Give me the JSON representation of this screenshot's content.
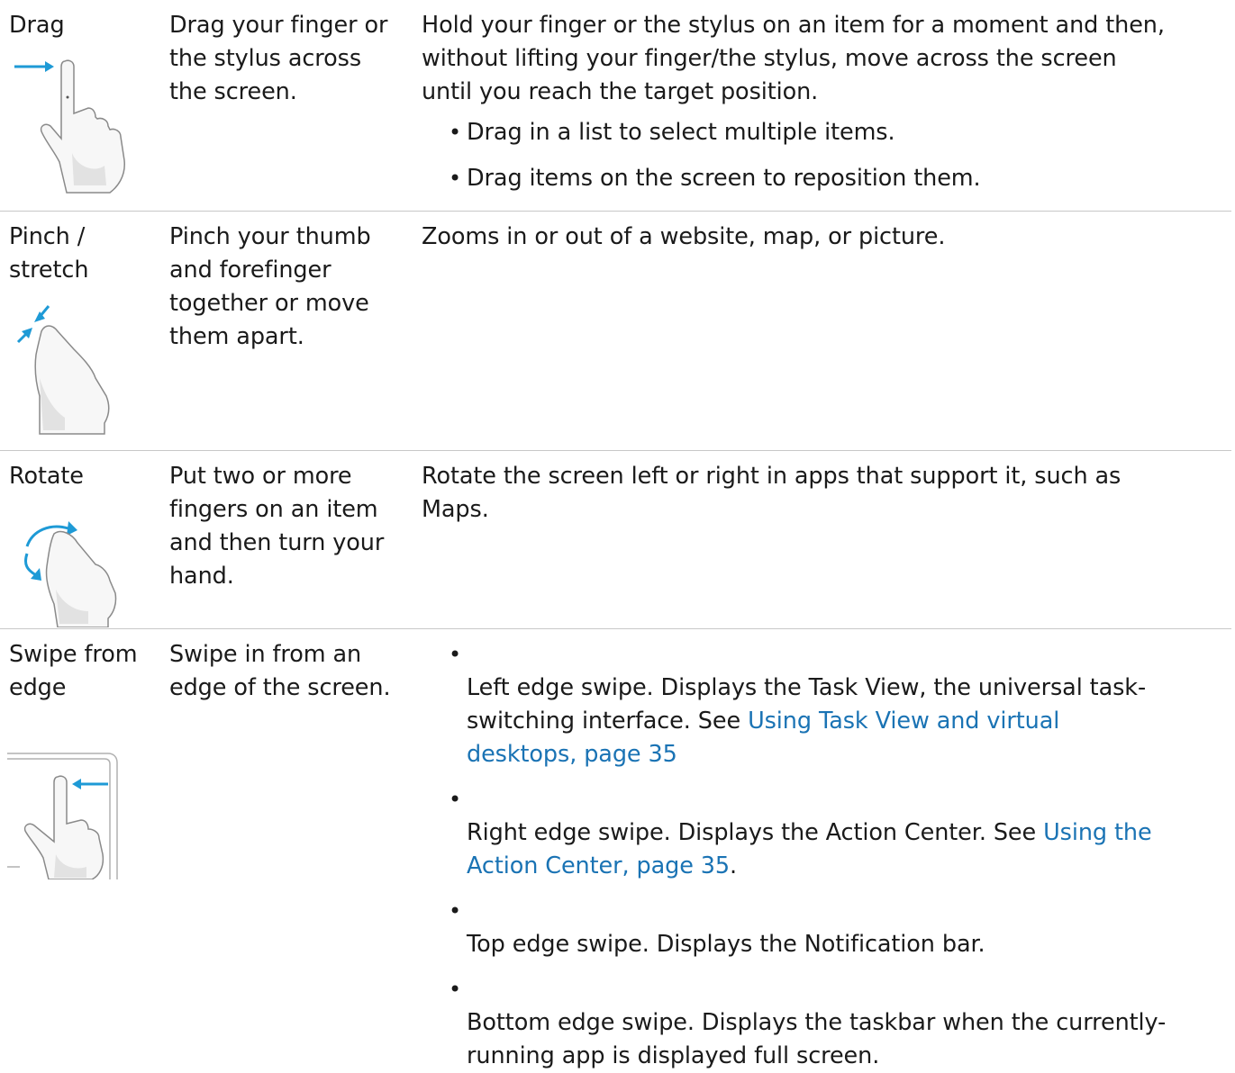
{
  "rows": [
    {
      "gesture": "Drag",
      "icon": "drag-gesture-icon",
      "action": "Drag your finger or\nthe stylus across\nthe screen.",
      "description": "Hold your finger or the stylus on an item for a moment and then,\nwithout lifting your finger/the stylus, move across the screen\nuntil you reach the target position.",
      "bullets": [
        "Drag in a list to select multiple items.",
        "Drag items on the screen to reposition them."
      ]
    },
    {
      "gesture": "Pinch /\nstretch",
      "icon": "pinch-stretch-gesture-icon",
      "action": "Pinch your thumb\nand forefinger\ntogether or move\nthem apart.",
      "description": "Zooms in or out of a website, map, or picture."
    },
    {
      "gesture": "Rotate",
      "icon": "rotate-gesture-icon",
      "action": "Put two or more\nfingers on an item\nand then turn your\nhand.",
      "description": "Rotate the screen left or right in apps that support it, such as\nMaps."
    },
    {
      "gesture": "Swipe from\nedge",
      "icon": "swipe-from-edge-gesture-icon",
      "action": "Swipe in from an\nedge of the screen.",
      "bullets": [
        {
          "text": "Left edge swipe. Displays the Task View, the universal task-\nswitching interface. See ",
          "link": "Using Task View and virtual\ndesktops, page 35",
          "after": ""
        },
        {
          "text": "Right edge swipe. Displays the Action Center. See ",
          "link": "Using the\nAction Center, page 35",
          "after": "."
        },
        {
          "text": "Top edge swipe. Displays the Notification bar."
        },
        {
          "text": "Bottom edge swipe. Displays the taskbar when the currently-\nrunning app is displayed full screen."
        }
      ]
    }
  ],
  "colors": {
    "link": "#1a73b4",
    "arrow": "#1e9ad6",
    "rule": "#c8c8c8",
    "text": "#1a1a1a"
  }
}
